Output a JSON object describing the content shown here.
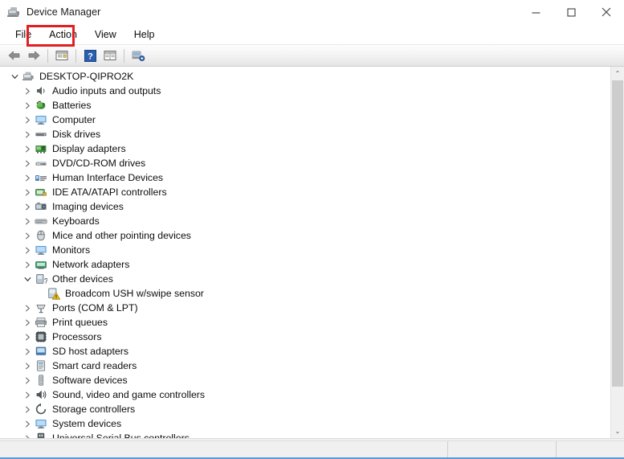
{
  "window": {
    "title": "Device Manager",
    "icon": "device-manager-icon",
    "controls": {
      "minimize": "—",
      "maximize": "☐",
      "close": "✕"
    }
  },
  "menubar": {
    "items": [
      {
        "label": "File",
        "name": "menu-file",
        "highlighted": false
      },
      {
        "label": "Action",
        "name": "menu-action",
        "highlighted": true
      },
      {
        "label": "View",
        "name": "menu-view",
        "highlighted": false
      },
      {
        "label": "Help",
        "name": "menu-help",
        "highlighted": false
      }
    ],
    "highlight_color": "#e02020"
  },
  "toolbar": {
    "buttons": [
      {
        "name": "back-arrow-icon",
        "tip": "Back"
      },
      {
        "name": "forward-arrow-icon",
        "tip": "Forward"
      },
      {
        "name": "separator-1",
        "tip": ""
      },
      {
        "name": "properties-icon",
        "tip": "Properties"
      },
      {
        "name": "separator-2",
        "tip": ""
      },
      {
        "name": "help-icon",
        "tip": "Help"
      },
      {
        "name": "show-hidden-devices-icon",
        "tip": "Show hidden devices"
      },
      {
        "name": "separator-3",
        "tip": ""
      },
      {
        "name": "scan-for-hardware-changes-icon",
        "tip": "Scan for hardware changes"
      }
    ]
  },
  "tree": {
    "nodes": [
      {
        "label": "DESKTOP-QIPRO2K",
        "level": 0,
        "state": "expanded",
        "icon": "computer-root-icon"
      },
      {
        "label": "Audio inputs and outputs",
        "level": 1,
        "state": "collapsed",
        "icon": "speaker-icon"
      },
      {
        "label": "Batteries",
        "level": 1,
        "state": "collapsed",
        "icon": "battery-icon"
      },
      {
        "label": "Computer",
        "level": 1,
        "state": "collapsed",
        "icon": "monitor-icon"
      },
      {
        "label": "Disk drives",
        "level": 1,
        "state": "collapsed",
        "icon": "disk-drive-icon"
      },
      {
        "label": "Display adapters",
        "level": 1,
        "state": "collapsed",
        "icon": "display-adapter-icon"
      },
      {
        "label": "DVD/CD-ROM drives",
        "level": 1,
        "state": "collapsed",
        "icon": "optical-drive-icon"
      },
      {
        "label": "Human Interface Devices",
        "level": 1,
        "state": "collapsed",
        "icon": "hid-icon"
      },
      {
        "label": "IDE ATA/ATAPI controllers",
        "level": 1,
        "state": "collapsed",
        "icon": "ide-controller-icon"
      },
      {
        "label": "Imaging devices",
        "level": 1,
        "state": "collapsed",
        "icon": "camera-icon"
      },
      {
        "label": "Keyboards",
        "level": 1,
        "state": "collapsed",
        "icon": "keyboard-icon"
      },
      {
        "label": "Mice and other pointing devices",
        "level": 1,
        "state": "collapsed",
        "icon": "mouse-icon"
      },
      {
        "label": "Monitors",
        "level": 1,
        "state": "collapsed",
        "icon": "monitor-icon"
      },
      {
        "label": "Network adapters",
        "level": 1,
        "state": "collapsed",
        "icon": "network-adapter-icon"
      },
      {
        "label": "Other devices",
        "level": 1,
        "state": "expanded",
        "icon": "other-device-icon"
      },
      {
        "label": "Broadcom USH w/swipe sensor",
        "level": 2,
        "state": "leaf",
        "icon": "unknown-device-warning-icon"
      },
      {
        "label": "Ports (COM & LPT)",
        "level": 1,
        "state": "collapsed",
        "icon": "port-icon"
      },
      {
        "label": "Print queues",
        "level": 1,
        "state": "collapsed",
        "icon": "printer-icon"
      },
      {
        "label": "Processors",
        "level": 1,
        "state": "collapsed",
        "icon": "processor-icon"
      },
      {
        "label": "SD host adapters",
        "level": 1,
        "state": "collapsed",
        "icon": "sd-host-icon"
      },
      {
        "label": "Smart card readers",
        "level": 1,
        "state": "collapsed",
        "icon": "smart-card-icon"
      },
      {
        "label": "Software devices",
        "level": 1,
        "state": "collapsed",
        "icon": "software-device-icon"
      },
      {
        "label": "Sound, video and game controllers",
        "level": 1,
        "state": "collapsed",
        "icon": "sound-icon"
      },
      {
        "label": "Storage controllers",
        "level": 1,
        "state": "collapsed",
        "icon": "storage-controller-icon"
      },
      {
        "label": "System devices",
        "level": 1,
        "state": "collapsed",
        "icon": "system-device-icon"
      },
      {
        "label": "Universal Serial Bus controllers",
        "level": 1,
        "state": "collapsed",
        "icon": "usb-icon"
      }
    ]
  },
  "scrollbar": {
    "up_arrow": "⌃",
    "down_arrow": "⌄"
  },
  "statusbar": {
    "main": "",
    "pane_a": "",
    "pane_b": ""
  }
}
